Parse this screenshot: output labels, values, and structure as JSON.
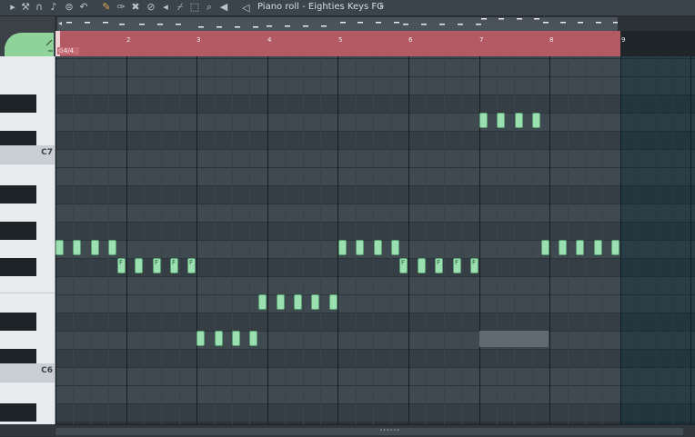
{
  "window": {
    "title": "Piano roll - Eighties Keys FG",
    "title_arrow": "▸"
  },
  "toolbar": {
    "icons": [
      "pointer-icon",
      "magnet-icon",
      "note-icon",
      "target-icon",
      "undo-icon",
      "pencil-icon",
      "brush-icon",
      "delete-icon",
      "mute-icon",
      "slice-icon",
      "select-icon",
      "zoom-icon",
      "playback-icon"
    ]
  },
  "ruler": {
    "bars": [
      "2",
      "3",
      "4",
      "5",
      "6",
      "7",
      "8",
      "9"
    ],
    "time_signature": "4/4"
  },
  "keyboard": {
    "c_labels": [
      "C7",
      "C6"
    ]
  },
  "notes": {
    "labels": [
      "F",
      "F",
      "F",
      "F",
      "F",
      "F",
      "F",
      "F",
      "F",
      "F"
    ]
  },
  "colors": {
    "note_fill": "#9ae0b0",
    "loop_region": "#b35a64",
    "grid_bg": "#3f4950"
  }
}
